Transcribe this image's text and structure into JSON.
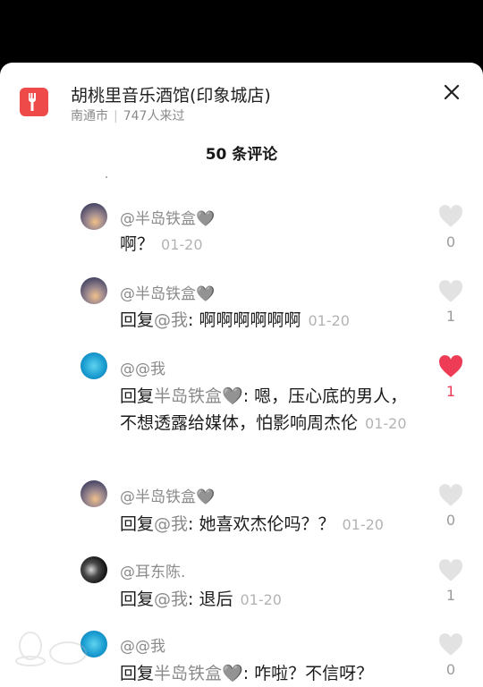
{
  "header": {
    "place_title": "胡桃里音乐酒馆(印象城店)",
    "city": "南通市",
    "visitors": "747人来过",
    "close_icon": "close-icon",
    "place_icon": "restaurant-fork-icon",
    "place_icon_color": "#ef4a4a"
  },
  "comments_count_title": "50 条评论",
  "comments": [
    {
      "user": "@半岛铁盒🩶",
      "reply_prefix": "",
      "reply_to": "",
      "text": "啊？",
      "time": "01-20",
      "likes": "0",
      "liked": false
    },
    {
      "user": "@半岛铁盒🩶",
      "reply_prefix": "回复",
      "reply_to": "@我",
      "text": ": 啊啊啊啊啊啊",
      "time": "01-20",
      "likes": "1",
      "liked": false
    },
    {
      "user": "@@我",
      "reply_prefix": "回复",
      "reply_to": "半岛铁盒🩶",
      "text": ": 嗯，压心底的男人，不想透露给媒体，怕影响周杰伦",
      "time": "01-20",
      "likes": "1",
      "liked": true
    },
    {
      "user": "@半岛铁盒🩶",
      "reply_prefix": "回复",
      "reply_to": "@我",
      "text": ": 她喜欢杰伦吗？？",
      "time": "01-20",
      "likes": "0",
      "liked": false
    },
    {
      "user": "@耳东陈.",
      "reply_prefix": "回复",
      "reply_to": "@我",
      "text": ": 退后",
      "time": "01-20",
      "likes": "1",
      "liked": false
    },
    {
      "user": "@@我",
      "reply_prefix": "回复",
      "reply_to": "半岛铁盒🩶",
      "text": ": 咋啦？不信呀？",
      "time": "",
      "likes": "0",
      "liked": false
    }
  ],
  "colors": {
    "liked_heart": "#ee3b56",
    "unliked_heart": "#e2e2e2"
  }
}
